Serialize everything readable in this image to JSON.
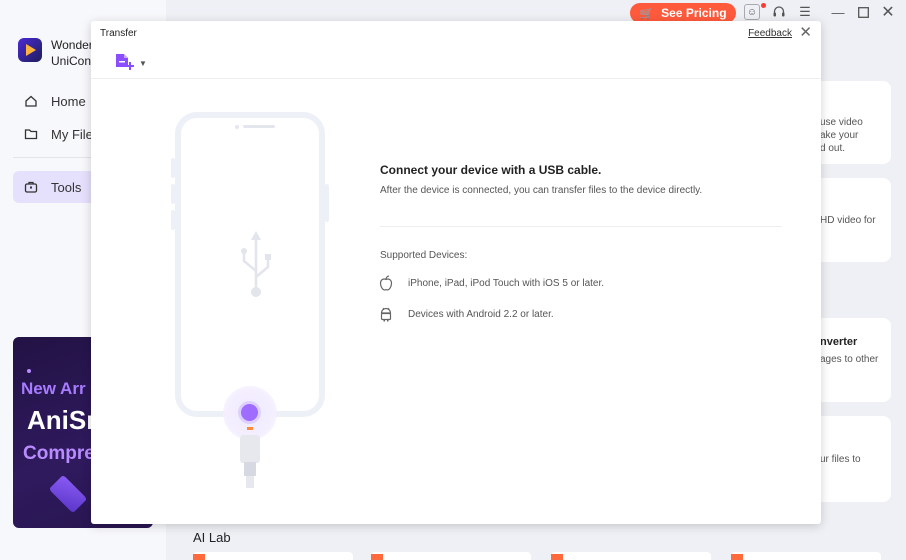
{
  "app": {
    "name_line1": "Wonder",
    "name_line2": "UniCon"
  },
  "sidebar": {
    "items": [
      {
        "label": "Home",
        "icon": "home-icon"
      },
      {
        "label": "My File",
        "icon": "folder-icon"
      },
      {
        "label": "Tools",
        "icon": "toolbox-icon",
        "active": true
      }
    ]
  },
  "promo": {
    "line1": "New Arr",
    "line2": "AniSr",
    "line3": "Compre"
  },
  "topbar": {
    "pricing_label": "See Pricing",
    "icons": [
      "cart-icon",
      "avatar-icon",
      "headset-icon",
      "menu-icon",
      "minimize-icon",
      "maximize-icon",
      "close-icon"
    ]
  },
  "background_cards": [
    {
      "text": [
        "use video",
        "ake your",
        "d out."
      ]
    },
    {
      "text": [
        "HD video for"
      ]
    },
    {
      "title": "nverter",
      "text": [
        "ages to other"
      ]
    },
    {
      "text": [
        "ur files to"
      ]
    }
  ],
  "ai_lab": {
    "label": "AI Lab"
  },
  "dialog": {
    "title": "Transfer",
    "feedback_label": "Feedback",
    "connect_title": "Connect your device with a USB cable.",
    "connect_desc": "After the device is connected, you can transfer files to the device directly.",
    "supported_label": "Supported Devices:",
    "devices": [
      {
        "icon": "apple-icon",
        "label": "iPhone, iPad, iPod Touch with iOS 5 or later."
      },
      {
        "icon": "android-icon",
        "label": "Devices with Android 2.2 or later."
      }
    ]
  },
  "colors": {
    "accent": "#9a5cff",
    "pricing": "#ff5a3c",
    "active_nav": "#e5e0fb"
  }
}
